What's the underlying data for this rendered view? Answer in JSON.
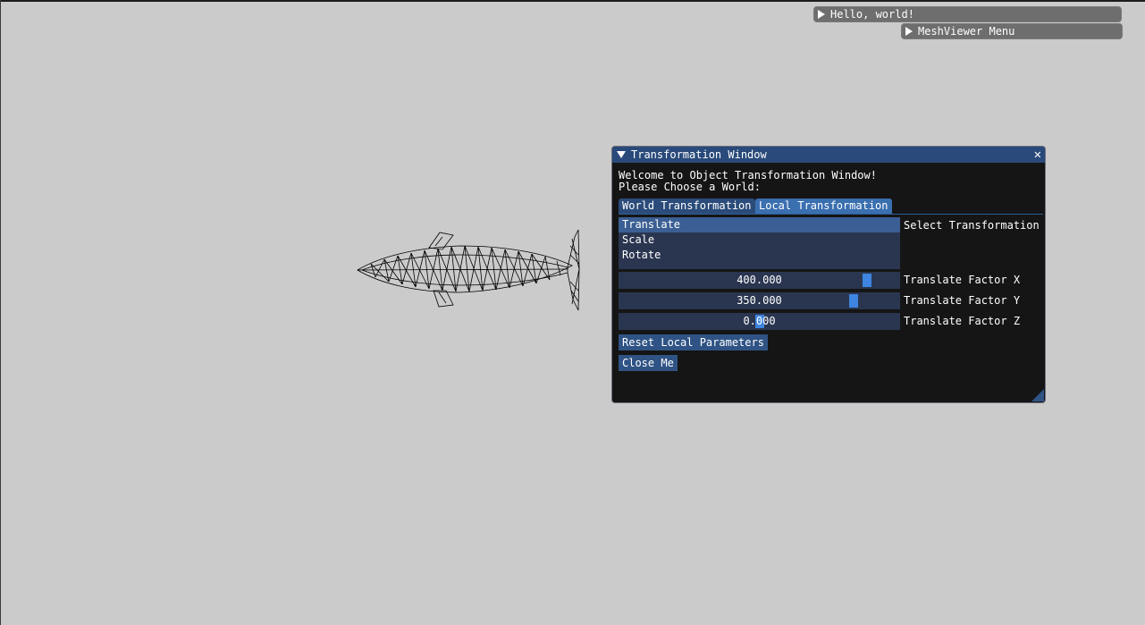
{
  "hello_window": {
    "title": "Hello, world!"
  },
  "mesh_menu": {
    "title": "MeshViewer Menu"
  },
  "window": {
    "title": "Transformation Window",
    "close_glyph": "✕",
    "intro_line1": "Welcome to Object Transformation Window!",
    "intro_line2": "Please Choose a World:",
    "tabs": [
      "World Transformation",
      "Local Transformation"
    ],
    "active_tab": "Local Transformation",
    "transform_list": [
      "Translate",
      "Scale",
      "Rotate"
    ],
    "selected_transform": "Translate",
    "list_label": "Select Transformation",
    "sliders": [
      {
        "value": "400.000",
        "label": "Translate Factor X"
      },
      {
        "value": "350.000",
        "label": "Translate Factor Y"
      },
      {
        "value": "0.000",
        "label": "Translate Factor Z"
      }
    ],
    "reset_button": "Reset Local Parameters",
    "close_button": "Close Me"
  },
  "colors": {
    "background": "#cbcbcb",
    "title_bar": "#294a7a",
    "window_bg": "#151515",
    "accent": "#3d85e0"
  },
  "icons": {
    "collapsed_arrow": "triangle-right-icon",
    "expanded_arrow": "triangle-down-icon",
    "close": "close-icon"
  }
}
